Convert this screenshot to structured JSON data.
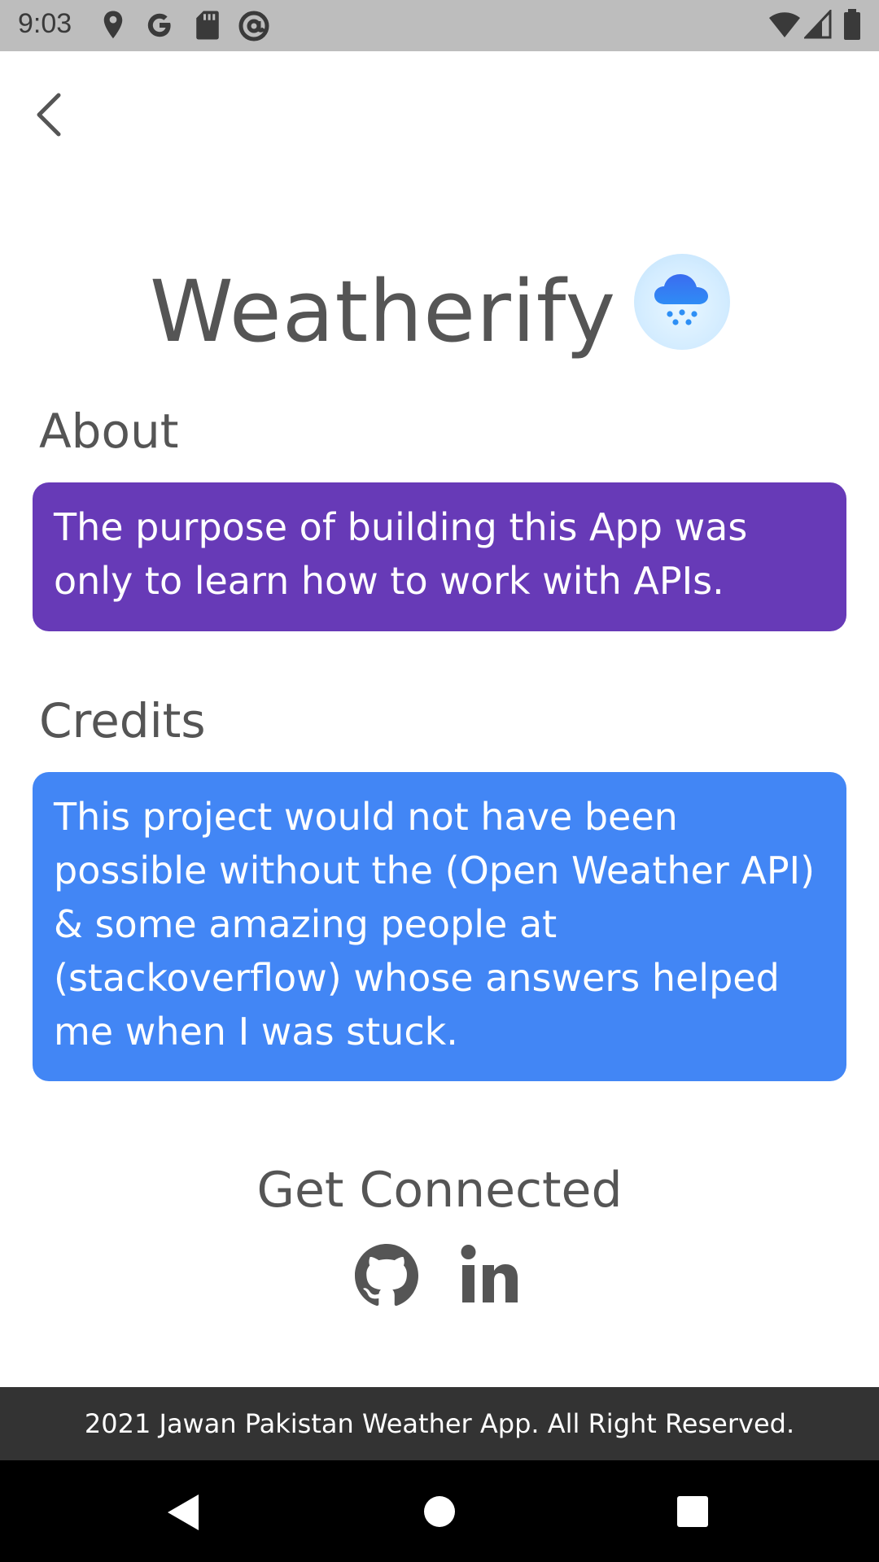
{
  "status_bar": {
    "time": "9:03",
    "left_icons": [
      "location-icon",
      "google-icon",
      "sd-card-icon",
      "at-sign-icon"
    ],
    "right_icons": [
      "wifi-icon",
      "signal-icon",
      "battery-icon"
    ]
  },
  "header": {
    "back_icon": "chevron-left-icon"
  },
  "app": {
    "title": "Weatherify",
    "logo_icon": "cloud-snow-icon"
  },
  "about": {
    "heading": "About",
    "text": "The purpose of building this App was only to learn how to work with APIs.",
    "color": "#673ab7"
  },
  "credits": {
    "heading": "Credits",
    "text": "This project would not have been possible without the (Open Weather API) & some amazing people at (stackoverflow) whose answers helped me when I was stuck.",
    "color": "#4286f5"
  },
  "connect": {
    "heading": "Get Connected",
    "links": [
      "github-icon",
      "linkedin-icon"
    ]
  },
  "footer": {
    "text": "2021 Jawan Pakistan Weather App. All Right Reserved."
  },
  "nav_bar": {
    "buttons": [
      "back-triangle-icon",
      "home-circle-icon",
      "recents-square-icon"
    ]
  }
}
